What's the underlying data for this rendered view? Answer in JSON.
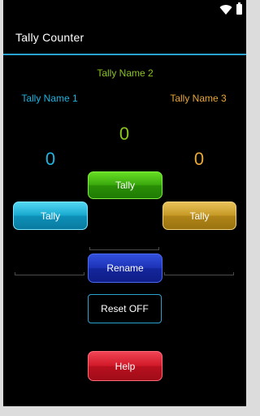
{
  "status_bar": {
    "icons": [
      "wifi-icon",
      "battery-icon"
    ]
  },
  "app": {
    "title": "Tally Counter",
    "accent": "#2aa2d0"
  },
  "tallies": [
    {
      "name": "Tally Name 1",
      "count": "0",
      "button_label": "Tally",
      "color": "#1eb4e0"
    },
    {
      "name": "Tally Name 2",
      "count": "0",
      "button_label": "Tally",
      "color": "#8cc41e"
    },
    {
      "name": "Tally Name 3",
      "count": "0",
      "button_label": "Tally",
      "color": "#e8a835"
    }
  ],
  "actions": {
    "rename_label": "Rename",
    "reset_label": "Reset OFF",
    "help_label": "Help"
  }
}
